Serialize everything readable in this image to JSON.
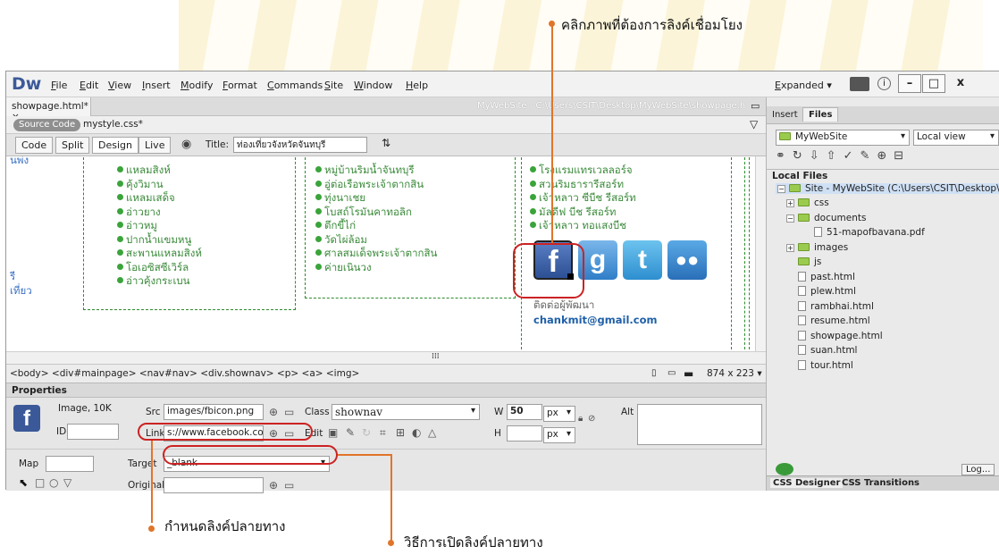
{
  "callouts": {
    "top": "คลิกภาพที่ต้องการลิงค์เชื่อมโยง",
    "bottom_left": "กำหนดลิงค์ปลายทาง",
    "bottom_right": "วิธีการเปิดลิงค์ปลายทาง"
  },
  "app": {
    "logo": "Dw",
    "menu": [
      "File",
      "Edit",
      "View",
      "Insert",
      "Modify",
      "Format",
      "Commands",
      "Site",
      "Window",
      "Help"
    ],
    "layout_mode": "Expanded",
    "window_buttons": [
      "–",
      "□",
      "x"
    ]
  },
  "document": {
    "tab_label": "showpage.html*",
    "tab_close": "×",
    "path": "MyWebSite - C:\\Users\\CSIT\\Desktop\\MyWebSite\\showpage.html",
    "source_code": "Source Code",
    "related_file": "mystyle.css*",
    "views": [
      "Code",
      "Split",
      "Design",
      "Live"
    ],
    "title_label": "Title:",
    "title_value": "ท่องเที่ยวจังหวัดจันทบุรี"
  },
  "content": {
    "col1": [
      "แหลมสิงห์",
      "คุ้งวิมาน",
      "แหลมเสด็จ",
      "อ่าวยาง",
      "อ่าวหมู",
      "ปากน้ำแขมหนู",
      "สะพานแหลมสิงห์",
      "โอเอซิสซีเวิร์ล",
      "อ่าวคุ้งกระเบน"
    ],
    "col2": [
      "หมู่บ้านริมน้ำจันทบุรี",
      "อู่ต่อเรือพระเจ้าตากสิน",
      "ทุ่งนาเชย",
      "โบสถ์โรมันคาทอลิก",
      "ตึกขี้ไก่",
      "วัดไผ่ล้อม",
      "ศาลสมเด็จพระเจ้าตากสิน",
      "ค่ายเนินวง"
    ],
    "col3": [
      "โรงแรมแทรเวลลอร์จ",
      "สวนริมธารารีสอร์ท",
      "เจ้าหลาว ซีบีช รีสอร์ท",
      "มัลดีฟ บีช รีสอร์ท",
      "เจ้าหลาว ทอแสงบีช"
    ],
    "left_snips": [
      "นพ่ง",
      "รี",
      "เที่ยว"
    ],
    "contact_label": "ติดต่อผู้พัฒนา",
    "contact_email": "chankmit@gmail.com"
  },
  "social_icons": [
    "facebook-icon",
    "google-plus-icon",
    "twitter-icon",
    "myspace-icon"
  ],
  "tag_selector": "<body> <div#mainpage> <nav#nav> <div.shownav> <p> <a> <img>",
  "window_size": "874 x 223",
  "properties": {
    "header": "Properties",
    "type": "Image, 10K",
    "id_label": "ID",
    "src_label": "Src",
    "src_value": "images/fbicon.png",
    "class_label": "Class",
    "class_value": "shownav",
    "w_label": "W",
    "w_value": "50",
    "h_label": "H",
    "unit": "px",
    "alt_label": "Alt",
    "link_label": "Link",
    "link_value": "s://www.facebook.com",
    "edit_label": "Edit",
    "map_label": "Map",
    "target_label": "Target",
    "target_value": "_blank",
    "original_label": "Original"
  },
  "panel": {
    "tabs": [
      "Insert",
      "Files"
    ],
    "site": "MyWebSite",
    "view": "Local view",
    "local_files": "Local Files",
    "root": "Site - MyWebSite (C:\\Users\\CSIT\\Desktop\\My...",
    "tree": [
      {
        "name": "css",
        "kind": "folder",
        "depth": 1,
        "toggle": "+"
      },
      {
        "name": "documents",
        "kind": "folder",
        "depth": 1,
        "toggle": "−"
      },
      {
        "name": "51-mapofbavana.pdf",
        "kind": "file",
        "depth": 2,
        "toggle": ""
      },
      {
        "name": "images",
        "kind": "folder",
        "depth": 1,
        "toggle": "+"
      },
      {
        "name": "js",
        "kind": "folder",
        "depth": 1,
        "toggle": ""
      },
      {
        "name": "past.html",
        "kind": "file",
        "depth": 1,
        "toggle": ""
      },
      {
        "name": "plew.html",
        "kind": "file",
        "depth": 1,
        "toggle": ""
      },
      {
        "name": "rambhai.html",
        "kind": "file",
        "depth": 1,
        "toggle": ""
      },
      {
        "name": "resume.html",
        "kind": "file",
        "depth": 1,
        "toggle": ""
      },
      {
        "name": "showpage.html",
        "kind": "file",
        "depth": 1,
        "toggle": ""
      },
      {
        "name": "suan.html",
        "kind": "file",
        "depth": 1,
        "toggle": ""
      },
      {
        "name": "tour.html",
        "kind": "file",
        "depth": 1,
        "toggle": ""
      }
    ],
    "log_button": "Log...",
    "bottom_tabs": [
      "CSS Designer",
      "CSS Transitions"
    ]
  },
  "colors": {
    "accent": "#e0752a",
    "ring": "#cc2222",
    "green": "#3a8a3a",
    "email": "#1f5fa8"
  }
}
